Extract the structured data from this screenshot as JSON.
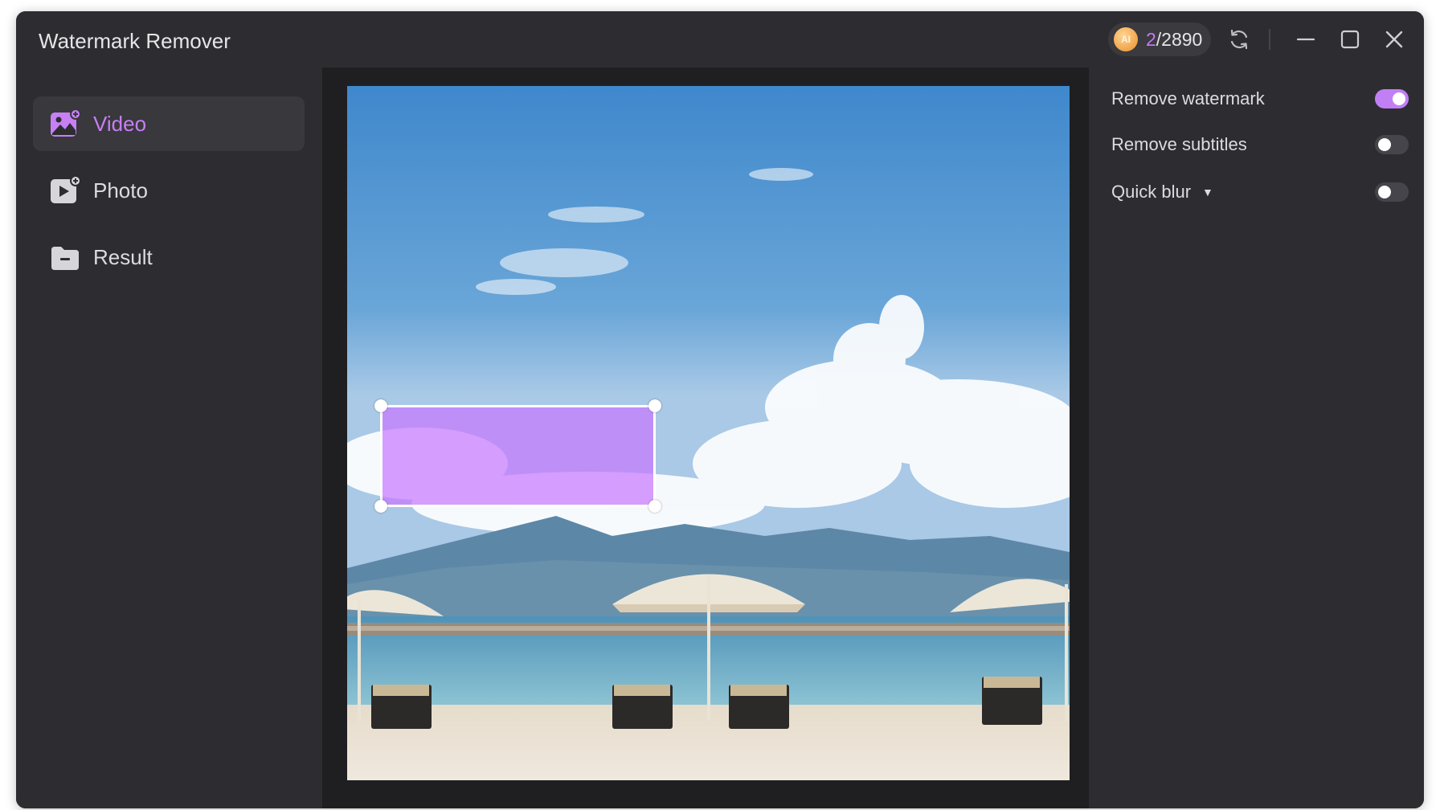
{
  "window": {
    "title": "Watermark Remover"
  },
  "credits": {
    "used": "2",
    "total": "/2890",
    "coin_icon_text": "AI"
  },
  "icons": {
    "coin": "ai-coin-icon",
    "refresh": "refresh-icon",
    "minimize": "minimize-icon",
    "maximize": "maximize-icon",
    "close": "close-icon"
  },
  "sidebar": {
    "items": [
      {
        "label": "Video",
        "icon": "video-image-icon",
        "active": true
      },
      {
        "label": "Photo",
        "icon": "play-photo-icon",
        "active": false
      },
      {
        "label": "Result",
        "icon": "folder-icon",
        "active": false
      }
    ]
  },
  "options": {
    "remove_watermark": {
      "label": "Remove watermark",
      "enabled": true
    },
    "remove_subtitles": {
      "label": "Remove subtitles",
      "enabled": false
    },
    "quick_blur": {
      "label": "Quick blur",
      "enabled": false
    }
  },
  "colors": {
    "accent": "#c77ff4",
    "window_bg": "#1f1f21",
    "panel_bg": "#2d2d31",
    "selection_fill": "#c878ff"
  }
}
